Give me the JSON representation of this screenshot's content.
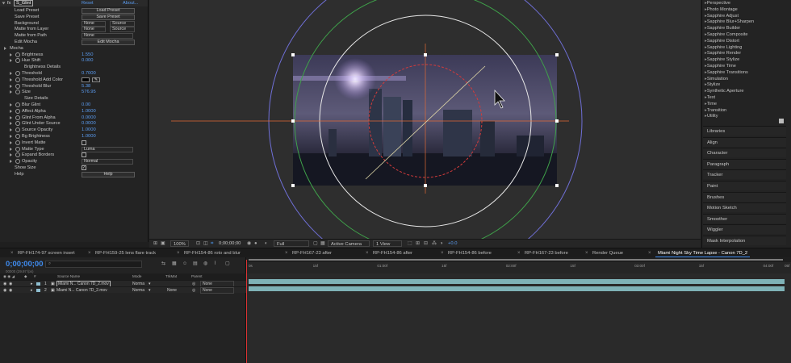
{
  "effect_controls": {
    "effect_name": "S_Glint",
    "reset": "Reset",
    "about": "About...",
    "rows": [
      {
        "label": "Load Preset",
        "button": "Load Preset"
      },
      {
        "label": "Save Preset",
        "button": "Save Preset"
      },
      {
        "label": "Background",
        "select1": "None",
        "select2": "Source"
      },
      {
        "label": "Matte from Layer",
        "select1": "None",
        "select2": "Source"
      },
      {
        "label": "Matte from Path",
        "select1": "None"
      },
      {
        "label": "Edit Mocha",
        "button": "Edit Mocha"
      },
      {
        "label": "Mocha"
      },
      {
        "label": "Brightness",
        "value": "1.550"
      },
      {
        "label": "Hue Shift",
        "value": "0.000"
      },
      {
        "label": "Brightness Details"
      },
      {
        "label": "Threshold",
        "value": "0.7000"
      },
      {
        "label": "Threshold Add Color"
      },
      {
        "label": "Threshold Blur",
        "value": "5.38"
      },
      {
        "label": "Size",
        "value": "576.95"
      },
      {
        "label": "Size Details"
      },
      {
        "label": "Blur Glint",
        "value": "0.00"
      },
      {
        "label": "Affect Alpha",
        "value": "1.0000"
      },
      {
        "label": "Glint From Alpha",
        "value": "0.0000"
      },
      {
        "label": "Glint Under Source",
        "value": "0.0000"
      },
      {
        "label": "Source Opacity",
        "value": "1.0000"
      },
      {
        "label": "Bg Brightness",
        "value": "1.0000"
      },
      {
        "label": "Invert Matte"
      },
      {
        "label": "Matte Type",
        "select1": "Luma"
      },
      {
        "label": "Expand Borders"
      },
      {
        "label": "Opacity",
        "select1": "Normal"
      },
      {
        "label": "Show Size"
      },
      {
        "label": "Help",
        "button": "Help"
      }
    ]
  },
  "viewer_bar": {
    "zoom": "100%",
    "timecode": "0;00;00;00",
    "resolution": "Full",
    "camera": "Active Camera",
    "views": "1 View",
    "exposure": "+0.0"
  },
  "effects_list": [
    "Perspective",
    "Photo Montage",
    "Sapphire Adjust",
    "Sapphire Blur+Sharpen",
    "Sapphire Builder",
    "Sapphire Composite",
    "Sapphire Distort",
    "Sapphire Lighting",
    "Sapphire Render",
    "Sapphire Stylize",
    "Sapphire Time",
    "Sapphire Transitions",
    "Simulation",
    "Stylize",
    "Synthetic Aperture",
    "Text",
    "Time",
    "Transition",
    "Utility"
  ],
  "panels": [
    "Libraries",
    "Align",
    "Character",
    "Paragraph",
    "Tracker",
    "Paint",
    "Brushes",
    "Motion Sketch",
    "Smoother",
    "Wiggler",
    "Mask Interpolation"
  ],
  "tabs": [
    "RP-FH174-97 screen insert",
    "RP-FH159-25 lens flare track",
    "RP-FH154-86 roto and blur",
    "RP-FH167-23 after",
    "RP-FH154-86 after",
    "RP-FH154-86 before",
    "RP-FH167-23 before",
    "Render Queue",
    "Miami Night Sky Time Lapse - Canon 7D_2"
  ],
  "timeline": {
    "timecode": "0;00;00;00",
    "timecode_sub": "00000 (29.97 fps)",
    "search_placeholder": "⌕",
    "headers": {
      "source": "Source Name",
      "mode": "Mode",
      "trkmat": "TrkMat",
      "parent": "Parent"
    },
    "layers": [
      {
        "num": "1",
        "name": "Miami N... Canon 7D_2.mov",
        "mode": "Norma",
        "trkmat": "",
        "parent": "None"
      },
      {
        "num": "2",
        "name": "Miami N... Canon 7D_2.mov",
        "mode": "Norma",
        "trkmat": "None",
        "parent": "None"
      }
    ],
    "ruler": [
      "0s",
      "05f",
      "10f",
      "15f",
      "20f",
      "25f",
      "01:00f",
      "05f",
      "10f",
      "15f",
      "20f",
      "25f",
      "02:00f",
      "05f",
      "10f",
      "15f",
      "20f",
      "25f",
      "03:00f",
      "05f",
      "10f",
      "15f",
      "20f",
      "25f",
      "04:00f",
      "05f"
    ]
  },
  "colors": {
    "accent": "#3f8cf0",
    "value_blue": "#5b9cf0",
    "layer_bar": "#7fb2b7",
    "cti": "#dd3333"
  }
}
